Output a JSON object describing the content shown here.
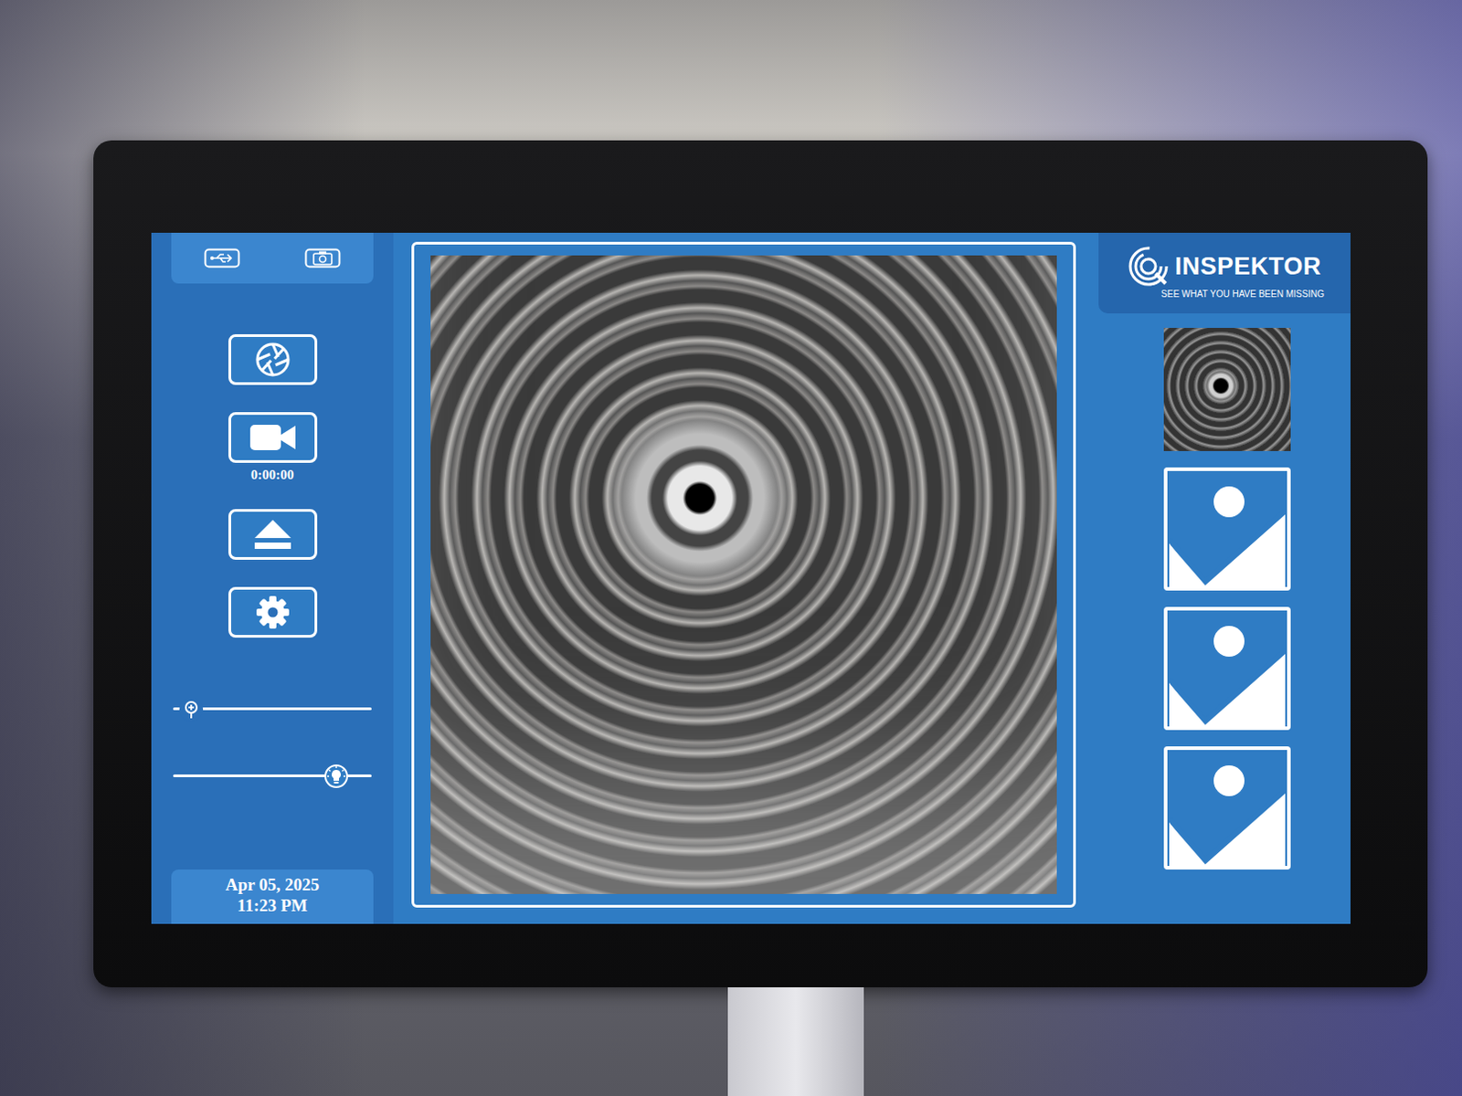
{
  "app": {
    "logo": "INSPEKTOR",
    "tagline": "SEE WHAT YOU HAVE BEEN MISSING"
  },
  "recording": {
    "timer": "0:00:00"
  },
  "sliders": [
    {
      "name": "zoom",
      "level": 0.09
    },
    {
      "name": "brightness",
      "level": 0.82
    }
  ],
  "datetime": {
    "date": "Apr 05, 2025",
    "time": "11:23 PM"
  },
  "thumbnails": [
    {
      "kind": "photo",
      "selected": false
    },
    {
      "kind": "placeholder",
      "selected": false
    },
    {
      "kind": "placeholder",
      "selected": false
    },
    {
      "kind": "placeholder",
      "selected": false
    }
  ]
}
